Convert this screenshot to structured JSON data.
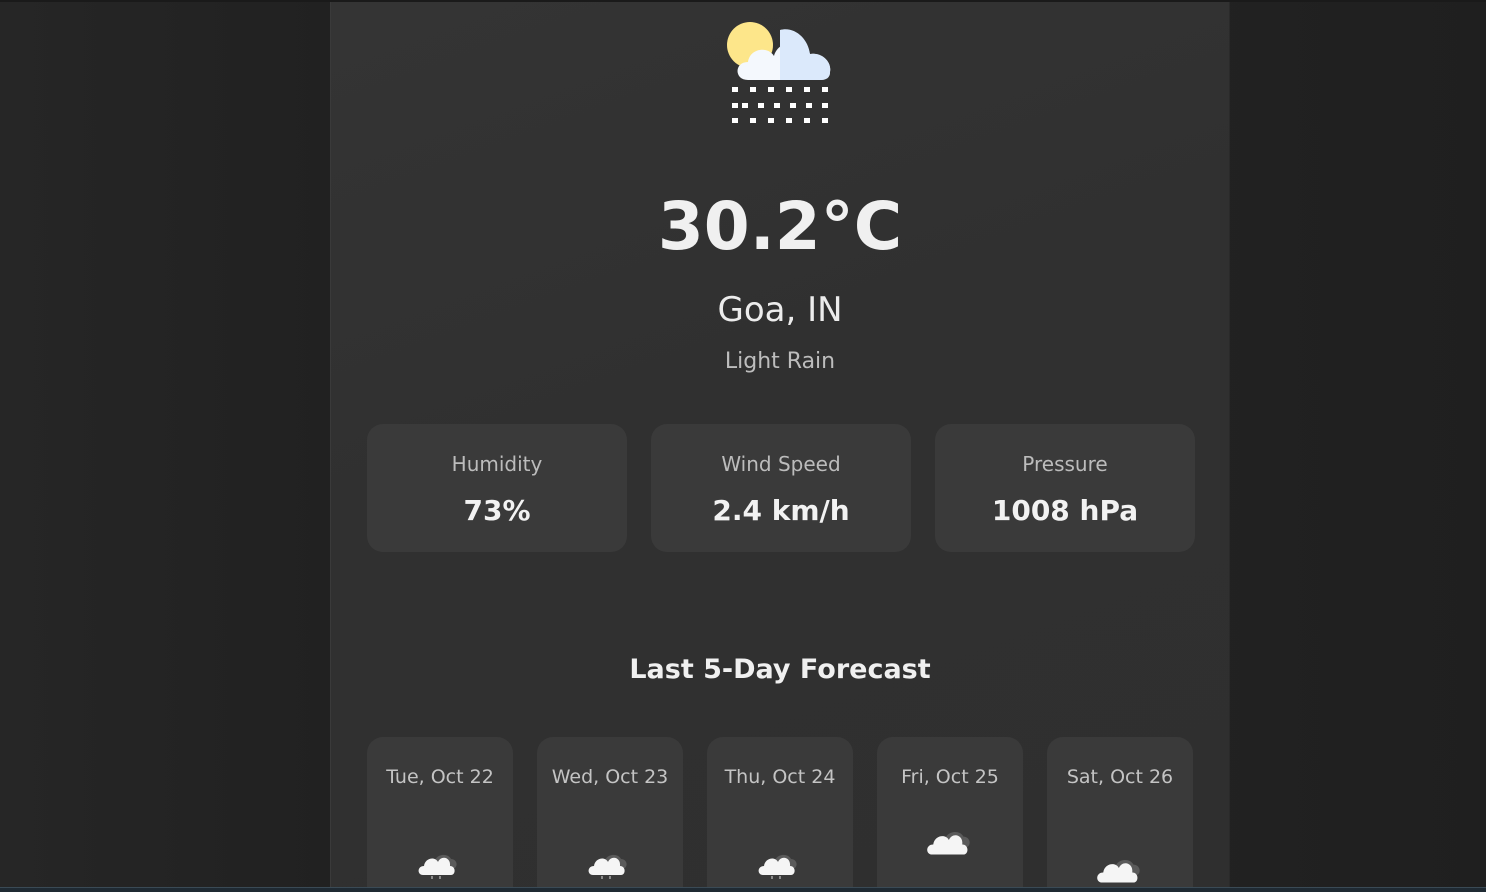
{
  "current": {
    "temperature": "30.2°C",
    "location": "Goa, IN",
    "condition": "Light Rain",
    "icon": "sun-cloud-rain-icon"
  },
  "stats": [
    {
      "label": "Humidity",
      "value": "73%"
    },
    {
      "label": "Wind Speed",
      "value": "2.4 km/h"
    },
    {
      "label": "Pressure",
      "value": "1008 hPa"
    }
  ],
  "forecast": {
    "title": "Last 5-Day Forecast",
    "days": [
      {
        "date": "Tue, Oct 22",
        "icon": "cloud-rain-icon"
      },
      {
        "date": "Wed, Oct 23",
        "icon": "cloud-rain-icon"
      },
      {
        "date": "Thu, Oct 24",
        "icon": "cloud-rain-icon"
      },
      {
        "date": "Fri, Oct 25",
        "icon": "cloud-icon"
      },
      {
        "date": "Sat, Oct 26",
        "icon": "cloud-icon"
      }
    ]
  },
  "colors": {
    "background": "#222222",
    "card": "#313131",
    "tile": "#3a3a3a",
    "sun": "#fde68a",
    "cloud": "#e0ecfa"
  }
}
